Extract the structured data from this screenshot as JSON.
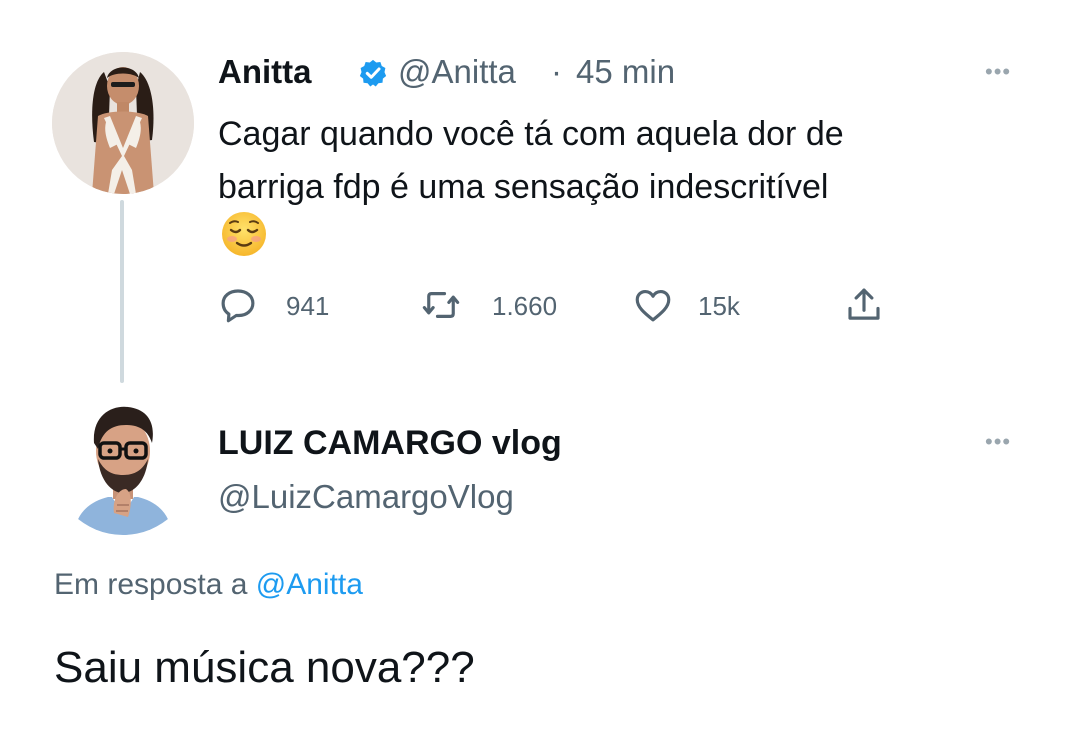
{
  "tweet": {
    "author_name": "Anitta",
    "author_handle": "@Anitta",
    "separator": "·",
    "time": "45 min",
    "text": "Cagar quando você tá com aquela dor de\nbarriga fdp é uma sensação indescritível",
    "emoji": "relieved-face-emoji",
    "avatar": "profile-photo",
    "verified_icon": "verified-badge-icon",
    "more_icon": "more-options-icon",
    "actions": {
      "reply": {
        "icon": "reply-icon",
        "count": "941"
      },
      "retweet": {
        "icon": "retweet-icon",
        "count": "1.660"
      },
      "like": {
        "icon": "heart-icon",
        "count": "15k"
      },
      "share": {
        "icon": "share-icon"
      }
    }
  },
  "reply": {
    "author_name": "LUIZ CAMARGO vlog",
    "author_handle": "@LuizCamargoVlog",
    "avatar": "cartoon-profile-photo",
    "more_icon": "more-options-icon",
    "context_prefix": "Em resposta a ",
    "context_handle": "@Anitta",
    "text": "Saiu música nova???"
  },
  "colors": {
    "text": "#0f1419",
    "secondary": "#536471",
    "accent": "#1d9bf0",
    "thread_line": "#cfd9de"
  }
}
